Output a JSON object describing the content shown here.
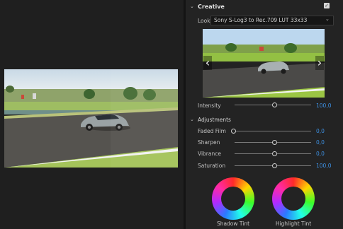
{
  "creative": {
    "title": "Creative",
    "look_label": "Look",
    "look_value": "Sony S-Log3 to Rec.709 LUT 33x33",
    "intensity_label": "Intensity",
    "intensity_value": "100,0",
    "intensity_level": 0.5
  },
  "adjustments": {
    "title": "Adjustments",
    "sliders": [
      {
        "label": "Faded Film",
        "value": "0,0",
        "level": 0.0
      },
      {
        "label": "Sharpen",
        "value": "0,0",
        "level": 0.5
      },
      {
        "label": "Vibrance",
        "value": "0,0",
        "level": 0.5
      },
      {
        "label": "Saturation",
        "value": "100,0",
        "level": 0.5
      }
    ]
  },
  "wheels": {
    "shadow_label": "Shadow Tint",
    "highlight_label": "Highlight Tint"
  },
  "colors": {
    "accent": "#3d8fe0",
    "panel_bg": "#232323"
  }
}
